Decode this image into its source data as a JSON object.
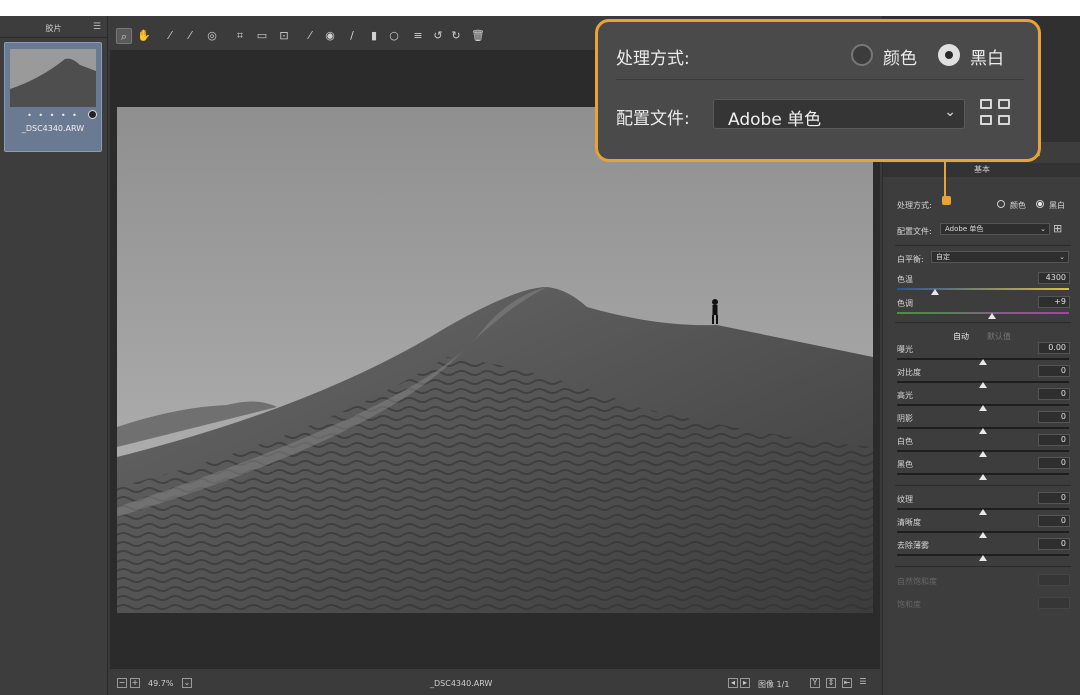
{
  "filmstrip": {
    "title": "胶片",
    "menu_icon": "menu-icon",
    "thumbnail": {
      "rating_dots": "• • • • •",
      "filename": "_DSC4340.ARW"
    }
  },
  "toolbar": {
    "tools": [
      "zoom-icon",
      "hand-icon",
      "white-balance-icon",
      "color-sampler-icon",
      "target-adjust-icon",
      "crop-icon",
      "straighten-icon",
      "transform-icon",
      "spot-removal-icon",
      "red-eye-icon",
      "adjustment-brush-icon",
      "graduated-filter-icon",
      "radial-filter-icon",
      "list-icon",
      "rotate-left-icon",
      "rotate-right-icon",
      "trash-icon"
    ]
  },
  "statusbar": {
    "zoom": "49.7%",
    "filename": "_DSC4340.ARW",
    "image_counter": "图像 1/1"
  },
  "panel": {
    "section_title": "基本",
    "treatment_label": "处理方式:",
    "color_option": "颜色",
    "bw_option": "黑白",
    "profile_label": "配置文件:",
    "profile_value": "Adobe 单色",
    "white_balance_label": "白平衡:",
    "white_balance_value": "自定",
    "auto": "自动",
    "default": "默认值",
    "sliders": [
      {
        "label": "色温",
        "value": "4300",
        "position": 0.22
      },
      {
        "label": "色调",
        "value": "+9",
        "position": 0.55
      },
      {
        "label": "曝光",
        "value": "0.00",
        "position": 0.5
      },
      {
        "label": "对比度",
        "value": "0",
        "position": 0.5
      },
      {
        "label": "高光",
        "value": "0",
        "position": 0.5
      },
      {
        "label": "阴影",
        "value": "0",
        "position": 0.5
      },
      {
        "label": "白色",
        "value": "0",
        "position": 0.5
      },
      {
        "label": "黑色",
        "value": "0",
        "position": 0.5
      },
      {
        "label": "纹理",
        "value": "0",
        "position": 0.5
      },
      {
        "label": "清晰度",
        "value": "0",
        "position": 0.5
      },
      {
        "label": "去除薄雾",
        "value": "0",
        "position": 0.5
      }
    ],
    "disabled": [
      "自然饱和度",
      "饱和度"
    ]
  },
  "callout": {
    "treatment_label": "处理方式:",
    "color_option": "颜色",
    "bw_option": "黑白",
    "selected": "黑白",
    "profile_label": "配置文件:",
    "profile_value": "Adobe 单色"
  },
  "colors": {
    "accent": "#e8a23a",
    "panel_bg": "#3d3d3d",
    "canvas_bg": "#2b2b2b"
  }
}
